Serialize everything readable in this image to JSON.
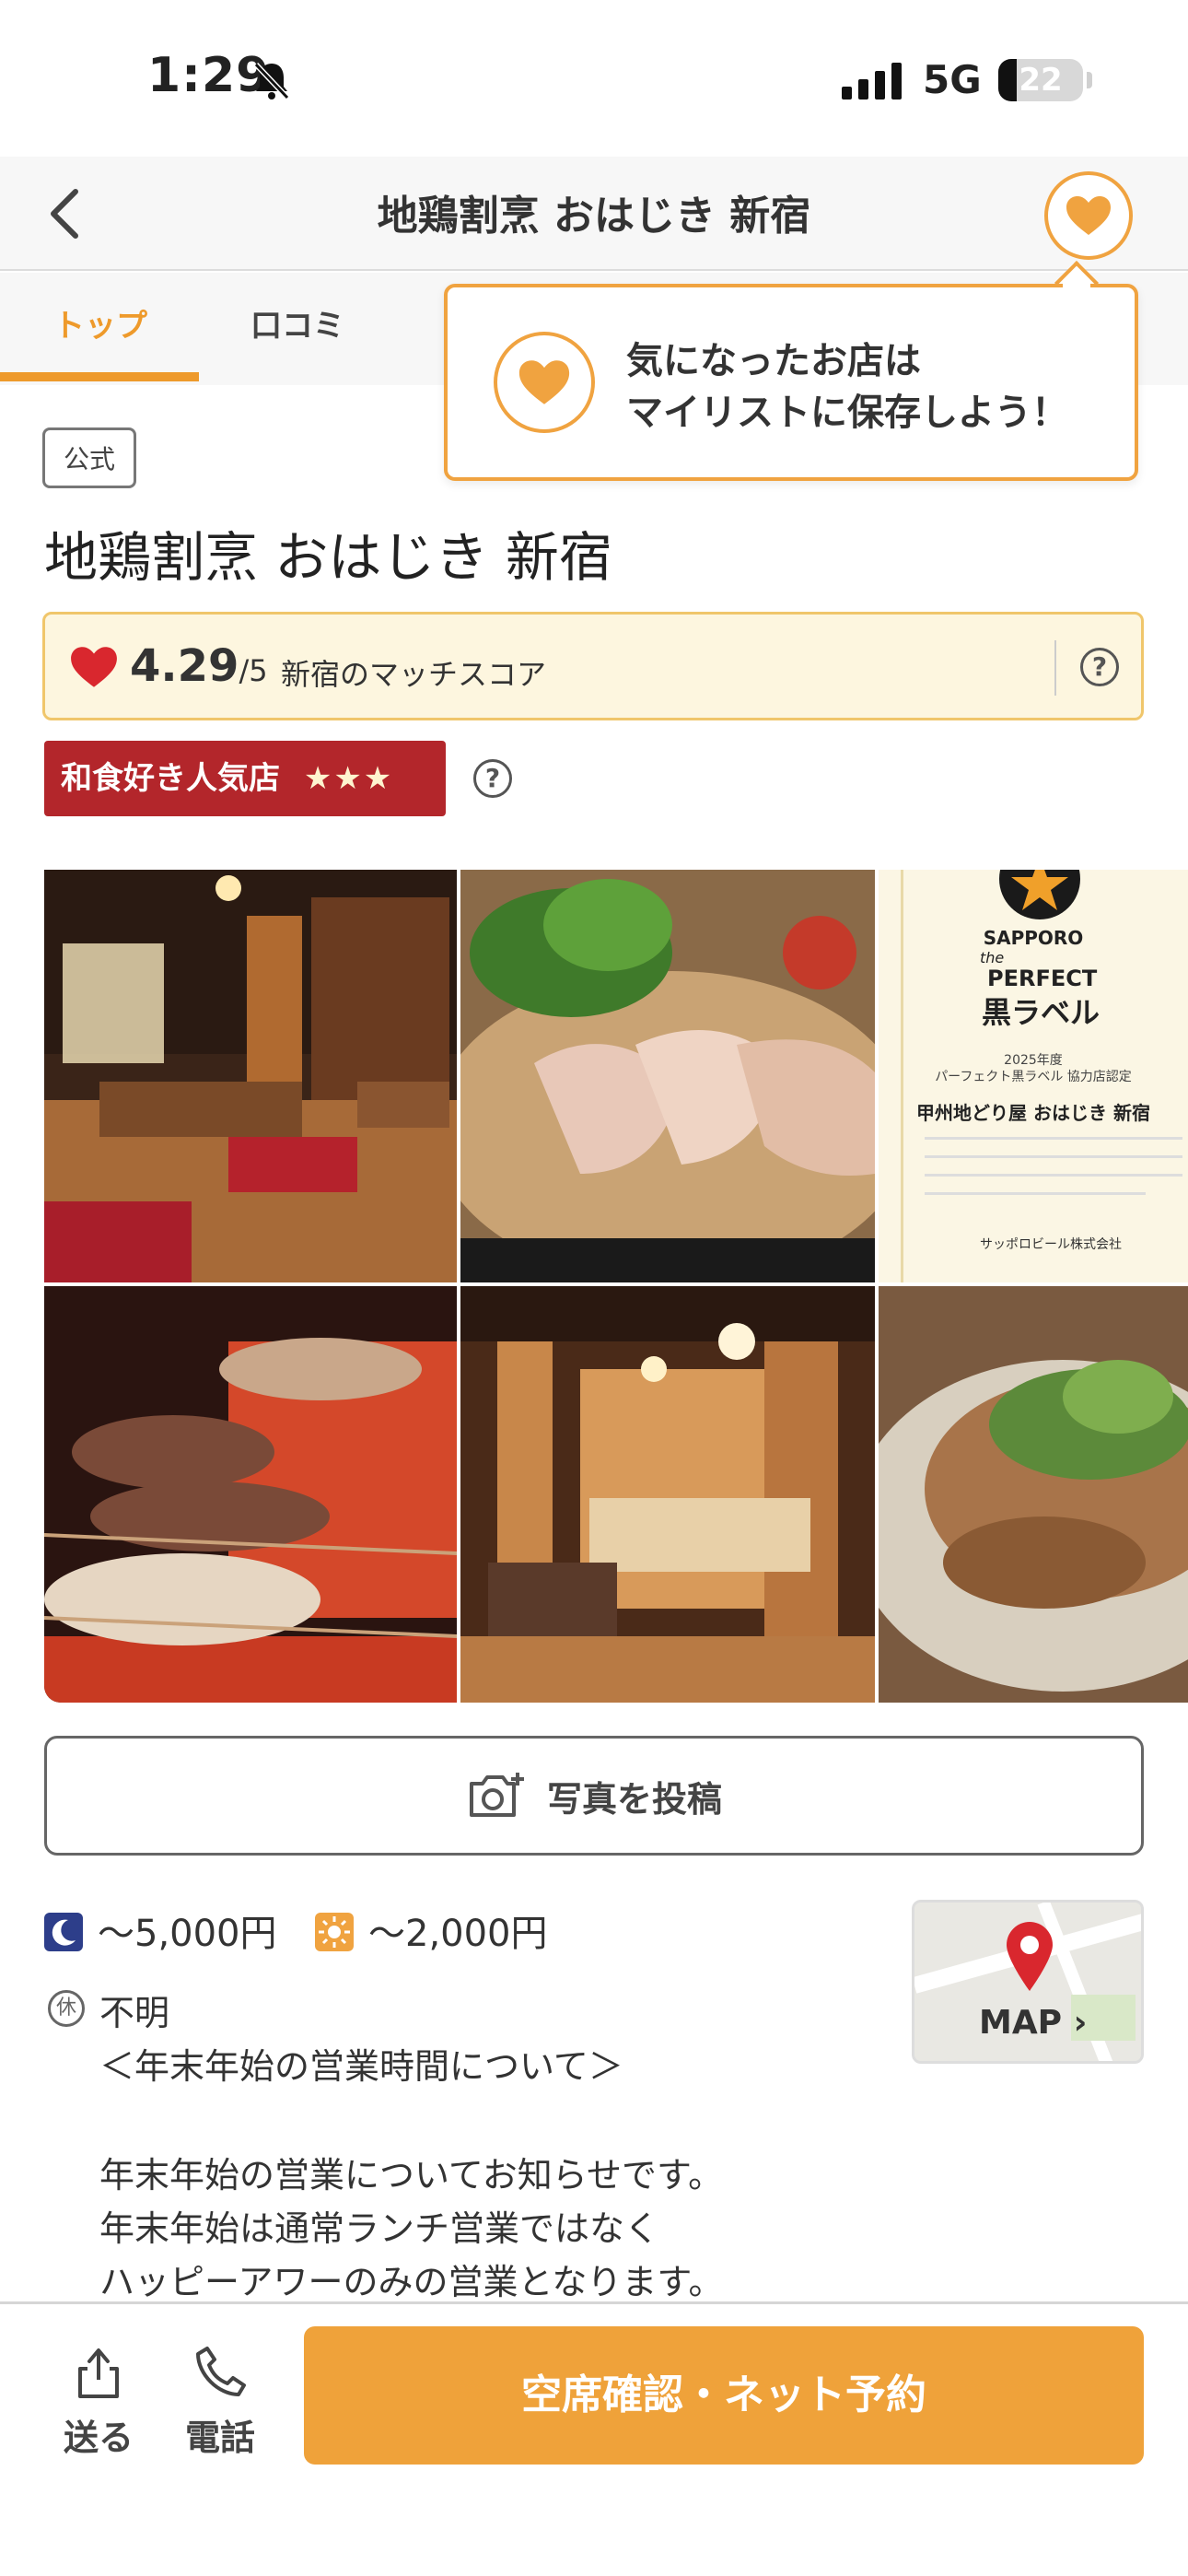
{
  "status_bar": {
    "time": "1:29",
    "network": "5G",
    "battery": "22",
    "battery_level": 0.22
  },
  "header": {
    "title": "地鶏割烹 おはじき 新宿"
  },
  "tabs": [
    {
      "label": "トップ",
      "active": true
    },
    {
      "label": "口コミ",
      "active": false
    }
  ],
  "tooltip": {
    "line1": "気になったお店は",
    "line2": "マイリストに保存しよう！"
  },
  "shop": {
    "official_badge": "公式",
    "name": "地鶏割烹 おはじき 新宿",
    "score": "4.29",
    "score_max": "/5",
    "score_label": "新宿のマッチスコア",
    "popular_badge": "和食好き人気店",
    "popular_stars": 3
  },
  "photos": [
    {
      "name": "photo-interior-1"
    },
    {
      "name": "photo-chicken-tataki"
    },
    {
      "name": "photo-sapporo-certificate",
      "brand": "SAPPORO",
      "brand_line1": "the",
      "brand_line2": "PERFECT",
      "brand_line3": "黒ラベル",
      "year_text": "2025年度",
      "cert_title": "パーフェクト黒ラベル 協力店認定",
      "shop_line": "甲州地どり屋 おはじき 新宿",
      "issuer": "サッポロビール株式会社"
    },
    {
      "name": "photo-yakitori"
    },
    {
      "name": "photo-interior-2"
    },
    {
      "name": "photo-dish"
    }
  ],
  "post_photo": {
    "label": "写真を投稿"
  },
  "budget": {
    "dinner": "～5,000円",
    "lunch": "～2,000円"
  },
  "map": {
    "label": "MAP ›"
  },
  "holiday": {
    "icon": "休",
    "value": "不明",
    "notice_title": "＜年末年始の営業時間について＞",
    "notice_lines": [
      "年末年始の営業についてお知らせです。",
      "年末年始は通常ランチ営業ではなく",
      "ハッピーアワーのみの営業となります。"
    ]
  },
  "bottom_bar": {
    "share_label": "送る",
    "phone_label": "電話",
    "reserve_label": "空席確認・ネット予約"
  },
  "colors": {
    "accent": "#ee9a2b",
    "badge_red": "#b3262b",
    "score_bg": "#fdf6df",
    "heart_red": "#d9272e"
  },
  "icons": [
    "bell-muted-icon",
    "signal-icon",
    "chevron-left-icon",
    "heart-icon",
    "help-icon",
    "camera-plus-icon",
    "moon-icon",
    "sun-icon",
    "map-pin-icon",
    "share-icon",
    "phone-icon"
  ]
}
